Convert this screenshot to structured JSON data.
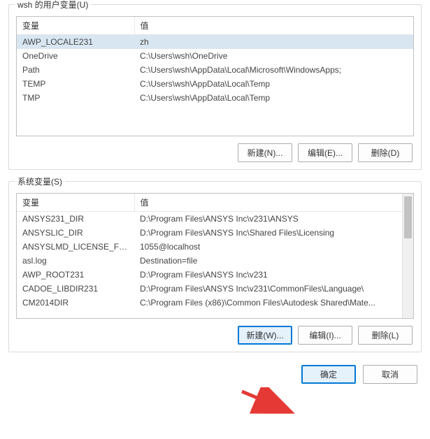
{
  "user_vars": {
    "group_label": "wsh 的用户变量(U)",
    "columns": {
      "name": "变量",
      "value": "值"
    },
    "rows": [
      {
        "name": "AWP_LOCALE231",
        "value": "zh",
        "selected": true
      },
      {
        "name": "OneDrive",
        "value": "C:\\Users\\wsh\\OneDrive"
      },
      {
        "name": "Path",
        "value": "C:\\Users\\wsh\\AppData\\Local\\Microsoft\\WindowsApps;"
      },
      {
        "name": "TEMP",
        "value": "C:\\Users\\wsh\\AppData\\Local\\Temp"
      },
      {
        "name": "TMP",
        "value": "C:\\Users\\wsh\\AppData\\Local\\Temp"
      }
    ],
    "buttons": {
      "new": "新建(N)...",
      "edit": "编辑(E)...",
      "delete": "删除(D)"
    }
  },
  "sys_vars": {
    "group_label": "系统变量(S)",
    "columns": {
      "name": "变量",
      "value": "值"
    },
    "rows": [
      {
        "name": "ANSYS231_DIR",
        "value": "D:\\Program Files\\ANSYS Inc\\v231\\ANSYS"
      },
      {
        "name": "ANSYSLIC_DIR",
        "value": "D:\\Program Files\\ANSYS Inc\\Shared Files\\Licensing"
      },
      {
        "name": "ANSYSLMD_LICENSE_FILE",
        "value": "1055@localhost"
      },
      {
        "name": "asl.log",
        "value": "Destination=file"
      },
      {
        "name": "AWP_ROOT231",
        "value": "D:\\Program Files\\ANSYS Inc\\v231"
      },
      {
        "name": "CADOE_LIBDIR231",
        "value": "D:\\Program Files\\ANSYS Inc\\v231\\CommonFiles\\Language\\"
      },
      {
        "name": "CM2014DIR",
        "value": "C:\\Program Files (x86)\\Common Files\\Autodesk Shared\\Mate..."
      }
    ],
    "buttons": {
      "new": "新建(W)...",
      "edit": "编辑(I)...",
      "delete": "删除(L)"
    }
  },
  "dialog": {
    "ok": "确定",
    "cancel": "取消"
  }
}
